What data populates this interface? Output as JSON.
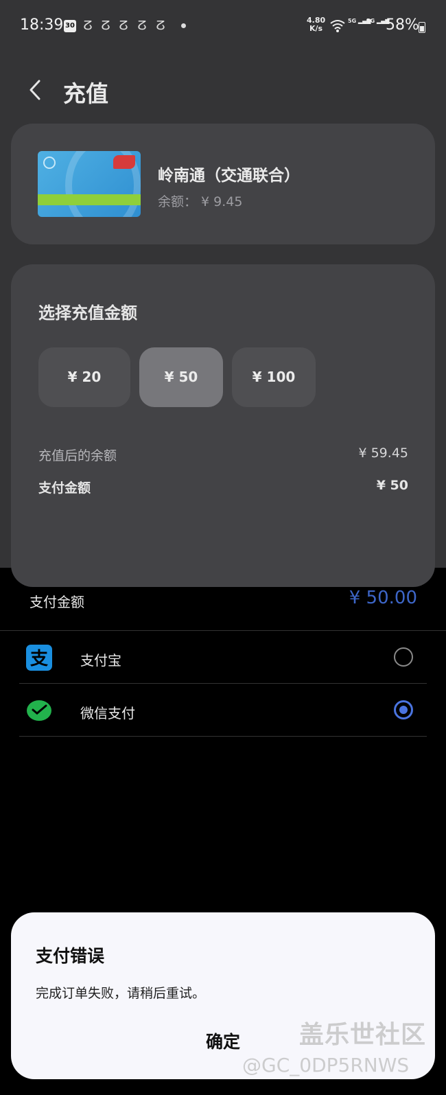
{
  "status_bar": {
    "time": "18:39",
    "calendar_day": "30",
    "net_speed_top": "4.80",
    "net_speed_bottom": "K/s",
    "signal1": "5G",
    "signal2": "5G",
    "battery": "58%"
  },
  "header": {
    "title": "充值"
  },
  "card": {
    "name": "岭南通（交通联合）",
    "balance_label": "余额： ¥ 9.45"
  },
  "amount": {
    "title": "选择充值金额",
    "options": [
      "¥ 20",
      "¥ 50",
      "¥ 100"
    ],
    "selected_index": 1,
    "after_label": "充值后的余额",
    "after_value": "¥ 59.45",
    "pay_label": "支付金额",
    "pay_value": "¥ 50"
  },
  "payment_sheet": {
    "amount_label": "支付金额",
    "amount_value": "¥ 50.00",
    "methods": [
      {
        "label": "支付宝",
        "icon": "alipay-icon",
        "selected": false
      },
      {
        "label": "微信支付",
        "icon": "wechat-pay-icon",
        "selected": true
      }
    ],
    "accent_color": "#4a74e0"
  },
  "dialog": {
    "title": "支付错误",
    "message": "完成订单失败，请稍后重试。",
    "confirm": "确定"
  },
  "watermark": {
    "site": "盖乐世社区",
    "user": "@GC_0DP5RNWS"
  }
}
